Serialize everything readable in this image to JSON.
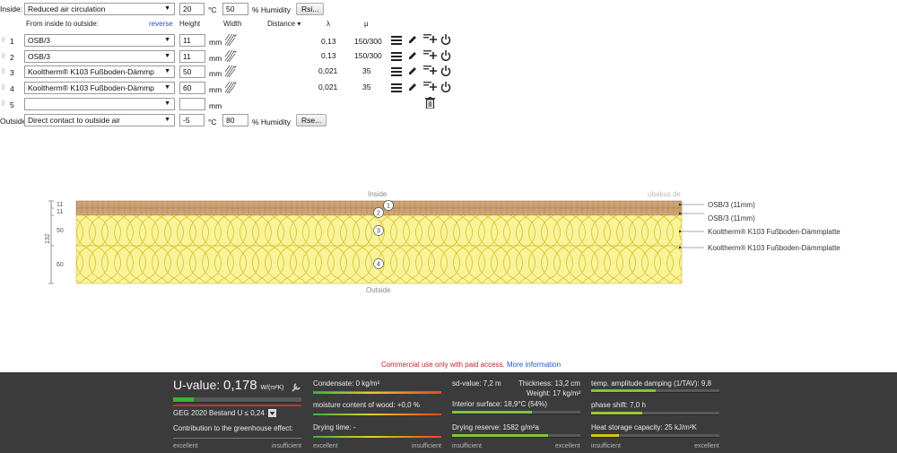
{
  "inside": {
    "label": "Inside:",
    "climate": "Reduced air circulation",
    "temp": "20",
    "temp_unit": "°C",
    "humidity": "50",
    "humidity_unit": "% Humidity",
    "button": "Rsi..."
  },
  "columns": {
    "from_inside": "From inside to outside:",
    "reverse": "reverse",
    "height": "Height",
    "width": "Width",
    "distance": "Distance ▾",
    "lambda": "λ",
    "mu": "μ"
  },
  "layers": [
    {
      "num": "1",
      "material": "OSB/3",
      "height": "11",
      "unit": "mm",
      "lambda": "0,13",
      "mu": "150/300",
      "color": "#c49a6a"
    },
    {
      "num": "2",
      "material": "OSB/3",
      "height": "11",
      "unit": "mm",
      "lambda": "0,13",
      "mu": "150/300",
      "color": "#c49a6a"
    },
    {
      "num": "3",
      "material": "Kooltherm® K103 Fußboden-Dämmp",
      "height": "50",
      "unit": "mm",
      "lambda": "0,021",
      "mu": "35",
      "color": "#f5ee8a"
    },
    {
      "num": "4",
      "material": "Kooltherm® K103 Fußboden-Dämmp",
      "height": "60",
      "unit": "mm",
      "lambda": "0,021",
      "mu": "35",
      "color": "#f5ee8a"
    },
    {
      "num": "5",
      "material": "",
      "height": "",
      "unit": "mm"
    }
  ],
  "outside": {
    "label": "Outside",
    "climate": "Direct contact to outside air",
    "temp": "-5",
    "temp_unit": "°C",
    "humidity": "80",
    "humidity_unit": "% Humidity",
    "button": "Rse..."
  },
  "diagram": {
    "inside_label": "Inside",
    "outside_label": "Outside",
    "watermark": "ubakus.de",
    "total": "132",
    "dims": [
      "11",
      "11",
      "50",
      "60"
    ],
    "circles": [
      "1",
      "2",
      "3",
      "4"
    ],
    "legend": [
      "OSB/3 (11mm)",
      "OSB/3 (11mm)",
      "Kooltherm® K103 Fußboden-Dämmplatte",
      "Kooltherm® K103 Fußboden-Dämmplatte"
    ]
  },
  "notice": {
    "text": "Commercial use only with paid access.",
    "link": "More information"
  },
  "results": {
    "uvalue_label": "U-value: ",
    "uvalue": "0,178",
    "uvalue_unit": "W/(m²K)",
    "standard": "GEG 2020 Bestand U ≤ 0,24",
    "greenhouse": "Contribution to the greenhouse effect:",
    "condensate": "Condensate: 0 kg/m²",
    "moisture_wood": "moisture content of wood: +0,0 %",
    "drying_time": "Drying time: -",
    "sd_value": "sd-value: 7,2 m",
    "thickness": "Thickness: 13,2 cm",
    "weight": "Weight: 17 kg/m²",
    "interior_surface": "Interior surface: 18,9°C (54%)",
    "drying_reserve": "Drying reserve: 1582 g/m²a",
    "temp_damping": "temp. amplitude damping (1/TAV): 9,8",
    "phase_shift": "phase shift: 7,0 h",
    "heat_storage": "Heat storage capacity: 25 kJ/m²K",
    "excellent": "excellent",
    "insufficient": "insufficient",
    "uvalue_level": 0.16,
    "interior_level": 0.62,
    "drying_reserve_level": 0.75,
    "damping_level": 0.5,
    "phase_level": 0.4,
    "heat_level": 0.22
  }
}
